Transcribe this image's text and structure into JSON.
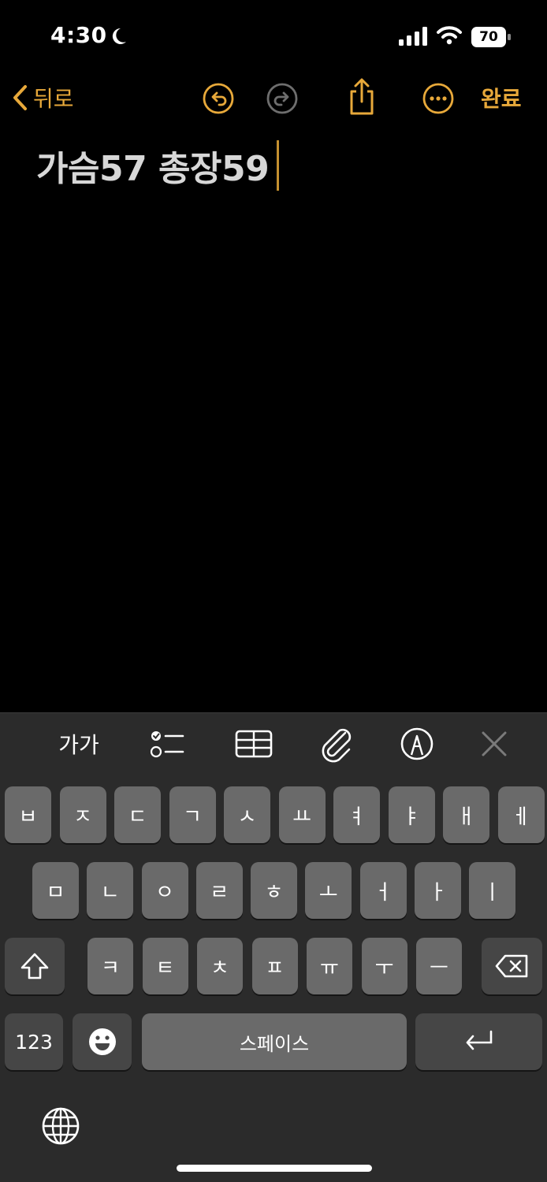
{
  "status_bar": {
    "time": "4:30",
    "battery": "70"
  },
  "nav": {
    "back_label": "뒤로",
    "done_label": "완료"
  },
  "note": {
    "text": "가슴57 총장59"
  },
  "toolbar": {
    "format_label": "가가"
  },
  "keyboard": {
    "row1": [
      "ㅂ",
      "ㅈ",
      "ㄷ",
      "ㄱ",
      "ㅅ",
      "ㅛ",
      "ㅕ",
      "ㅑ",
      "ㅐ",
      "ㅔ"
    ],
    "row2": [
      "ㅁ",
      "ㄴ",
      "ㅇ",
      "ㄹ",
      "ㅎ",
      "ㅗ",
      "ㅓ",
      "ㅏ",
      "ㅣ"
    ],
    "row3": [
      "ㅋ",
      "ㅌ",
      "ㅊ",
      "ㅍ",
      "ㅠ",
      "ㅜ",
      "ㅡ"
    ],
    "numbers_label": "123",
    "space_label": "스페이스"
  },
  "colors": {
    "accent": "#e8a93a",
    "background": "#000000",
    "keyboard_bg": "#2b2b2b",
    "key_bg": "#6a6a6a",
    "key_dark_bg": "#464646"
  },
  "icons": {
    "moon": "moon-icon",
    "signal": "cellular-signal-icon",
    "wifi": "wifi-icon",
    "battery": "battery-icon",
    "back": "chevron-left-icon",
    "undo": "undo-icon",
    "redo": "redo-icon",
    "share": "share-icon",
    "more": "more-icon",
    "checklist": "checklist-icon",
    "table": "table-icon",
    "attachment": "paperclip-icon",
    "markup": "pen-markup-icon",
    "close": "close-icon",
    "shift": "shift-icon",
    "delete": "backspace-icon",
    "emoji": "emoji-icon",
    "return": "return-icon",
    "globe": "globe-icon"
  }
}
